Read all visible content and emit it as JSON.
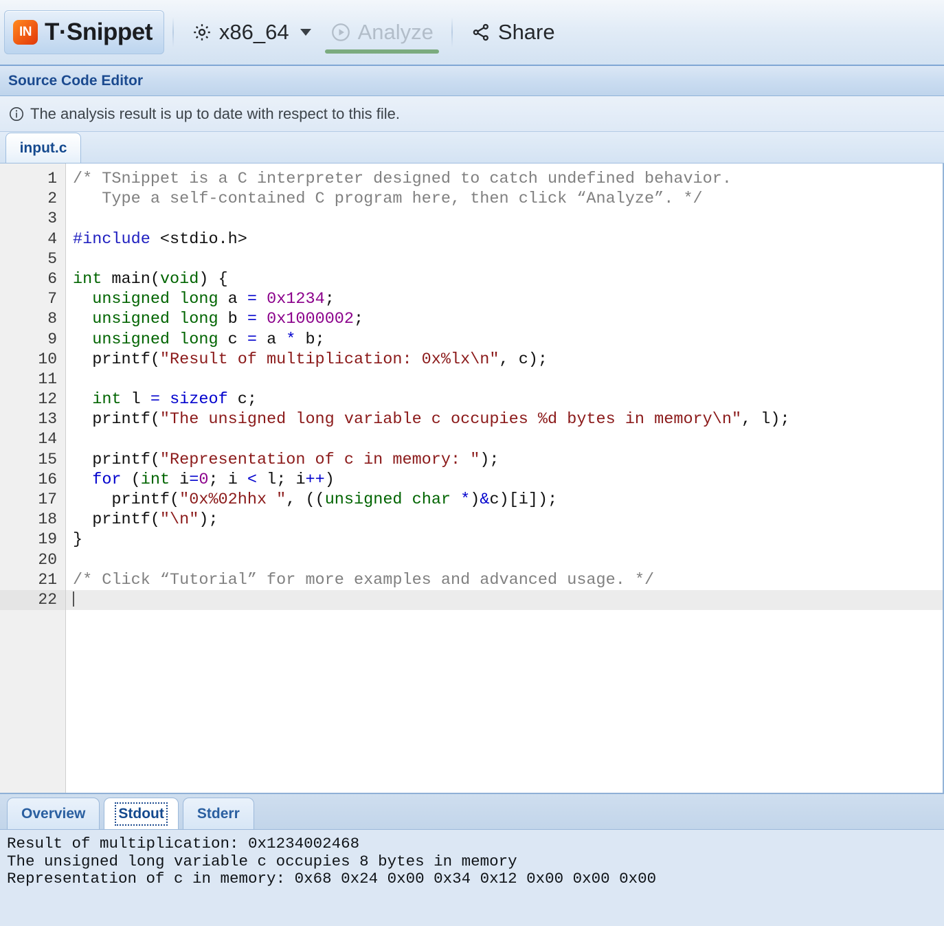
{
  "app": {
    "brand_mark": "IN",
    "brand_name": "T·Snippet",
    "accent_orange": "#f05a12",
    "accent_blue": "#14498e",
    "accent_green": "#7bab7f"
  },
  "toolbar": {
    "arch_label": "x86_64",
    "arch_icon": "gear-icon",
    "arch_caret": "chevron-down-icon",
    "analyze_label": "Analyze",
    "analyze_icon": "play-circle-icon",
    "analyze_enabled": false,
    "share_label": "Share",
    "share_icon": "share-nodes-icon"
  },
  "section": {
    "title": "Source Code Editor"
  },
  "info": {
    "icon": "info-circle-icon",
    "message": "The analysis result is up to date with respect to this file."
  },
  "file_tabs": [
    {
      "label": "input.c",
      "active": true
    }
  ],
  "editor": {
    "active_line": 22,
    "line_numbers": [
      "1",
      "2",
      "3",
      "4",
      "5",
      "6",
      "7",
      "8",
      "9",
      "10",
      "11",
      "12",
      "13",
      "14",
      "15",
      "16",
      "17",
      "18",
      "19",
      "20",
      "21",
      "22"
    ],
    "lines": [
      {
        "n": 1,
        "tokens": [
          {
            "t": "/* TSnippet is a C interpreter designed to catch undefined behavior.",
            "c": "cm"
          }
        ]
      },
      {
        "n": 2,
        "tokens": [
          {
            "t": "   Type a self-contained C program here, then click “Analyze”. */",
            "c": "cm"
          }
        ]
      },
      {
        "n": 3,
        "tokens": []
      },
      {
        "n": 4,
        "tokens": [
          {
            "t": "#include",
            "c": "pp"
          },
          {
            "t": " <stdio.h>",
            "c": ""
          }
        ]
      },
      {
        "n": 5,
        "tokens": []
      },
      {
        "n": 6,
        "tokens": [
          {
            "t": "int",
            "c": "k"
          },
          {
            "t": " main(",
            "c": ""
          },
          {
            "t": "void",
            "c": "k"
          },
          {
            "t": ") {",
            "c": ""
          }
        ]
      },
      {
        "n": 7,
        "tokens": [
          {
            "t": "  ",
            "c": ""
          },
          {
            "t": "unsigned long",
            "c": "k"
          },
          {
            "t": " a ",
            "c": ""
          },
          {
            "t": "=",
            "c": "kb"
          },
          {
            "t": " ",
            "c": ""
          },
          {
            "t": "0x1234",
            "c": "nu"
          },
          {
            "t": ";",
            "c": ""
          }
        ]
      },
      {
        "n": 8,
        "tokens": [
          {
            "t": "  ",
            "c": ""
          },
          {
            "t": "unsigned long",
            "c": "k"
          },
          {
            "t": " b ",
            "c": ""
          },
          {
            "t": "=",
            "c": "kb"
          },
          {
            "t": " ",
            "c": ""
          },
          {
            "t": "0x1000002",
            "c": "nu"
          },
          {
            "t": ";",
            "c": ""
          }
        ]
      },
      {
        "n": 9,
        "tokens": [
          {
            "t": "  ",
            "c": ""
          },
          {
            "t": "unsigned long",
            "c": "k"
          },
          {
            "t": " c ",
            "c": ""
          },
          {
            "t": "=",
            "c": "kb"
          },
          {
            "t": " a ",
            "c": ""
          },
          {
            "t": "*",
            "c": "kb"
          },
          {
            "t": " b;",
            "c": ""
          }
        ]
      },
      {
        "n": 10,
        "tokens": [
          {
            "t": "  printf(",
            "c": ""
          },
          {
            "t": "\"Result of multiplication: 0x%lx\\n\"",
            "c": "st"
          },
          {
            "t": ", c);",
            "c": ""
          }
        ]
      },
      {
        "n": 11,
        "tokens": []
      },
      {
        "n": 12,
        "tokens": [
          {
            "t": "  ",
            "c": ""
          },
          {
            "t": "int",
            "c": "k"
          },
          {
            "t": " l ",
            "c": ""
          },
          {
            "t": "=",
            "c": "kb"
          },
          {
            "t": " ",
            "c": ""
          },
          {
            "t": "sizeof",
            "c": "kb"
          },
          {
            "t": " c;",
            "c": ""
          }
        ]
      },
      {
        "n": 13,
        "tokens": [
          {
            "t": "  printf(",
            "c": ""
          },
          {
            "t": "\"The unsigned long variable c occupies %d bytes in memory\\n\"",
            "c": "st"
          },
          {
            "t": ", l);",
            "c": ""
          }
        ]
      },
      {
        "n": 14,
        "tokens": []
      },
      {
        "n": 15,
        "tokens": [
          {
            "t": "  printf(",
            "c": ""
          },
          {
            "t": "\"Representation of c in memory: \"",
            "c": "st"
          },
          {
            "t": ");",
            "c": ""
          }
        ]
      },
      {
        "n": 16,
        "tokens": [
          {
            "t": "  ",
            "c": ""
          },
          {
            "t": "for",
            "c": "kb"
          },
          {
            "t": " (",
            "c": ""
          },
          {
            "t": "int",
            "c": "k"
          },
          {
            "t": " i",
            "c": ""
          },
          {
            "t": "=",
            "c": "kb"
          },
          {
            "t": "0",
            "c": "nu"
          },
          {
            "t": "; i ",
            "c": ""
          },
          {
            "t": "<",
            "c": "kb"
          },
          {
            "t": " l; i",
            "c": ""
          },
          {
            "t": "++",
            "c": "kb"
          },
          {
            "t": ")",
            "c": ""
          }
        ]
      },
      {
        "n": 17,
        "tokens": [
          {
            "t": "    printf(",
            "c": ""
          },
          {
            "t": "\"0x%02hhx \"",
            "c": "st"
          },
          {
            "t": ", ((",
            "c": ""
          },
          {
            "t": "unsigned char",
            "c": "k"
          },
          {
            "t": " ",
            "c": ""
          },
          {
            "t": "*",
            "c": "kb"
          },
          {
            "t": ")",
            "c": ""
          },
          {
            "t": "&",
            "c": "kb"
          },
          {
            "t": "c)[i]);",
            "c": ""
          }
        ]
      },
      {
        "n": 18,
        "tokens": [
          {
            "t": "  printf(",
            "c": ""
          },
          {
            "t": "\"\\n\"",
            "c": "st"
          },
          {
            "t": ");",
            "c": ""
          }
        ]
      },
      {
        "n": 19,
        "tokens": [
          {
            "t": "}",
            "c": ""
          }
        ]
      },
      {
        "n": 20,
        "tokens": []
      },
      {
        "n": 21,
        "tokens": [
          {
            "t": "/* Click “Tutorial” for more examples and advanced usage. */",
            "c": "cm"
          }
        ]
      },
      {
        "n": 22,
        "tokens": [],
        "cursor": true
      }
    ]
  },
  "output": {
    "tabs": [
      {
        "label": "Overview",
        "active": false
      },
      {
        "label": "Stdout",
        "active": true
      },
      {
        "label": "Stderr",
        "active": false
      }
    ],
    "stdout_lines": [
      "Result of multiplication: 0x1234002468",
      "The unsigned long variable c occupies 8 bytes in memory",
      "Representation of c in memory: 0x68 0x24 0x00 0x34 0x12 0x00 0x00 0x00"
    ]
  }
}
